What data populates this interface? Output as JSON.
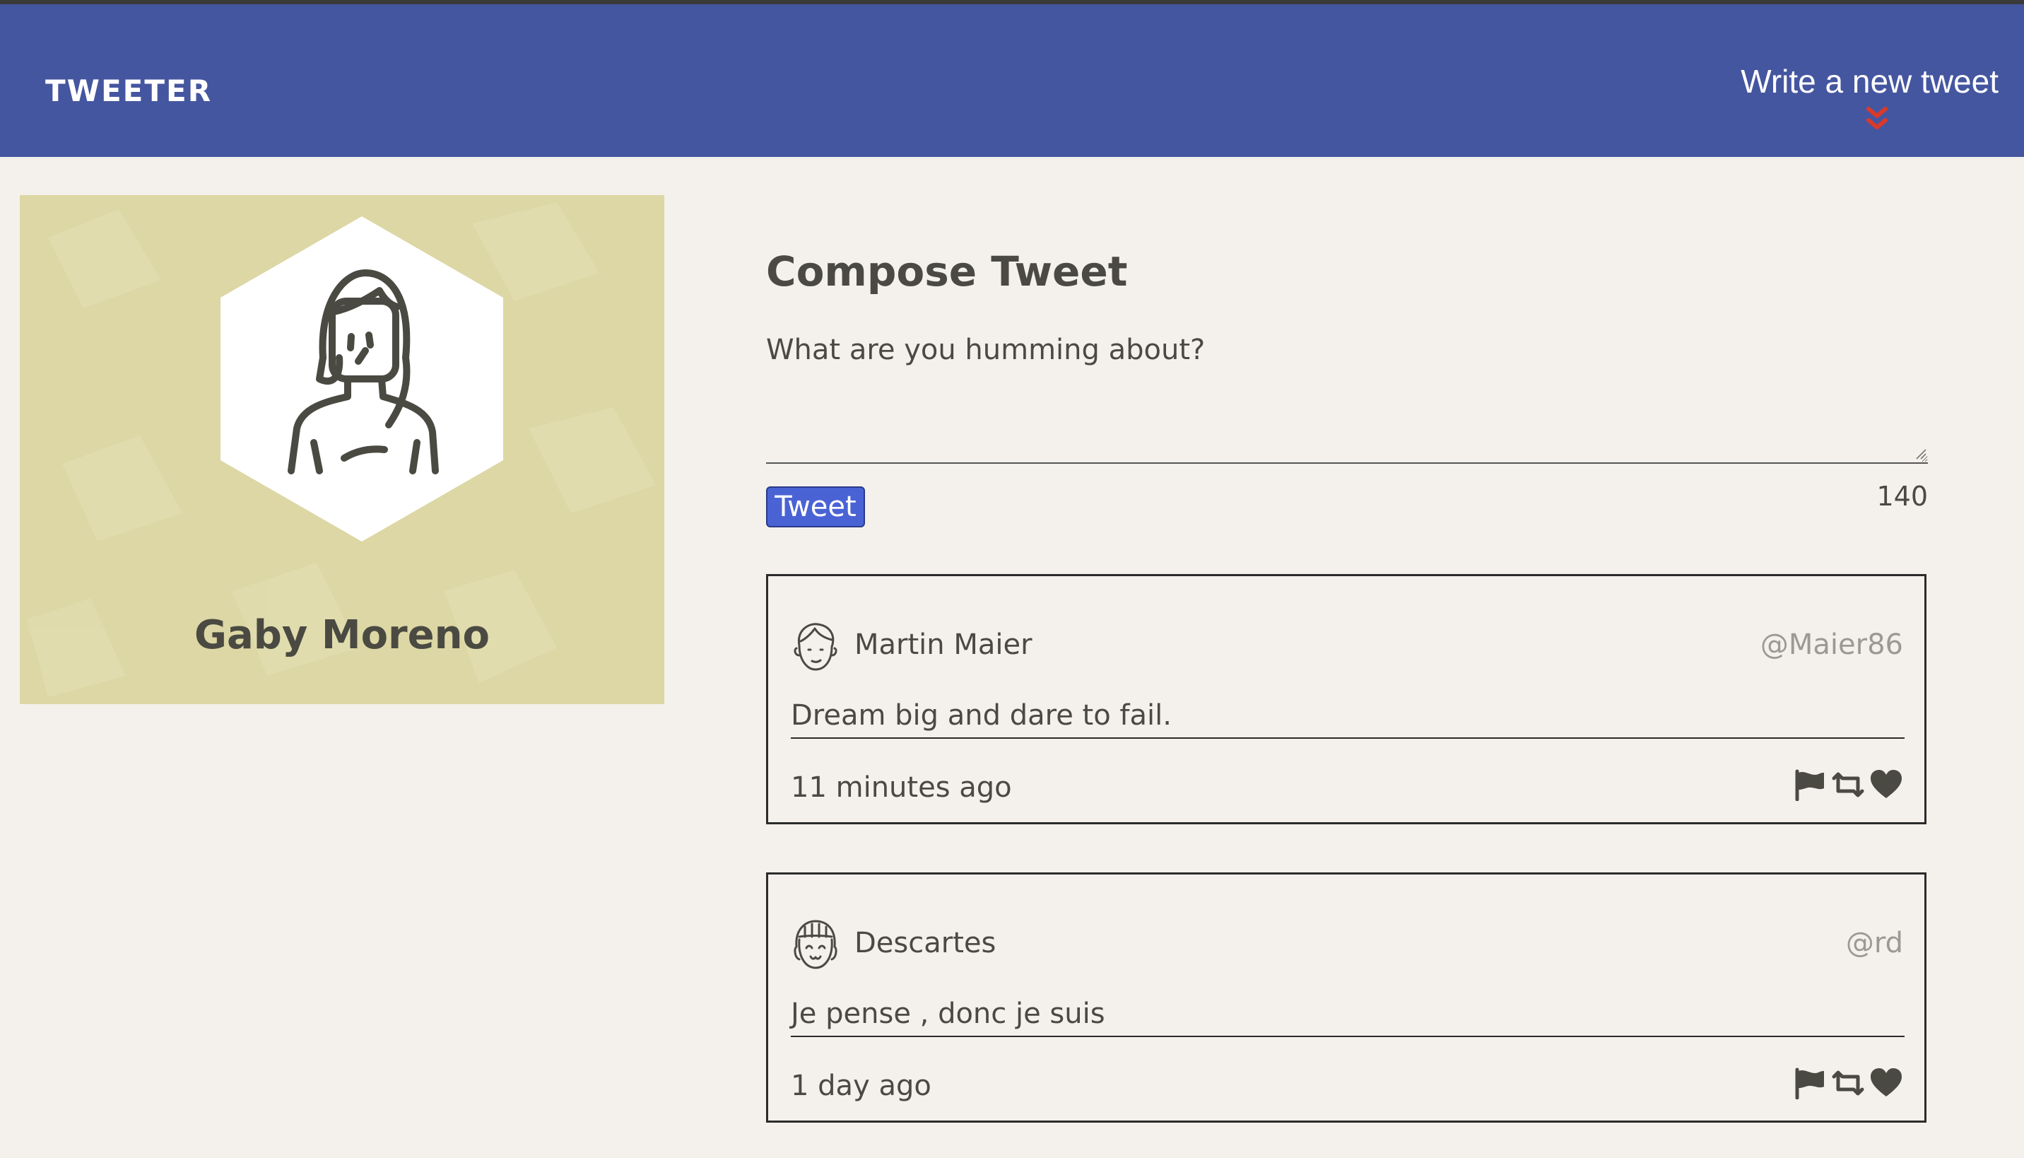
{
  "nav": {
    "brand": "TWEETER",
    "new_tweet_label": "Write a new tweet",
    "accent_color": "#d93a2b",
    "bar_color": "#4556a0"
  },
  "profile": {
    "name": "Gaby Moreno",
    "card_color": "#dcd7a4",
    "avatar_icon": "woman-avatar-icon"
  },
  "compose": {
    "title": "Compose Tweet",
    "placeholder": "What are you humming about?",
    "value": "",
    "button_label": "Tweet",
    "counter": "140"
  },
  "tweets": [
    {
      "author": "Martin Maier",
      "handle": "@Maier86",
      "text": "Dream big and dare to fail.",
      "time": "11 minutes ago",
      "avatar_icon": "man-avatar-icon",
      "actions": [
        "flag-icon",
        "retweet-icon",
        "heart-icon"
      ]
    },
    {
      "author": "Descartes",
      "handle": "@rd",
      "text": "Je pense , donc je suis",
      "time": "1 day ago",
      "avatar_icon": "smiling-avatar-icon",
      "actions": [
        "flag-icon",
        "retweet-icon",
        "heart-icon"
      ]
    }
  ]
}
